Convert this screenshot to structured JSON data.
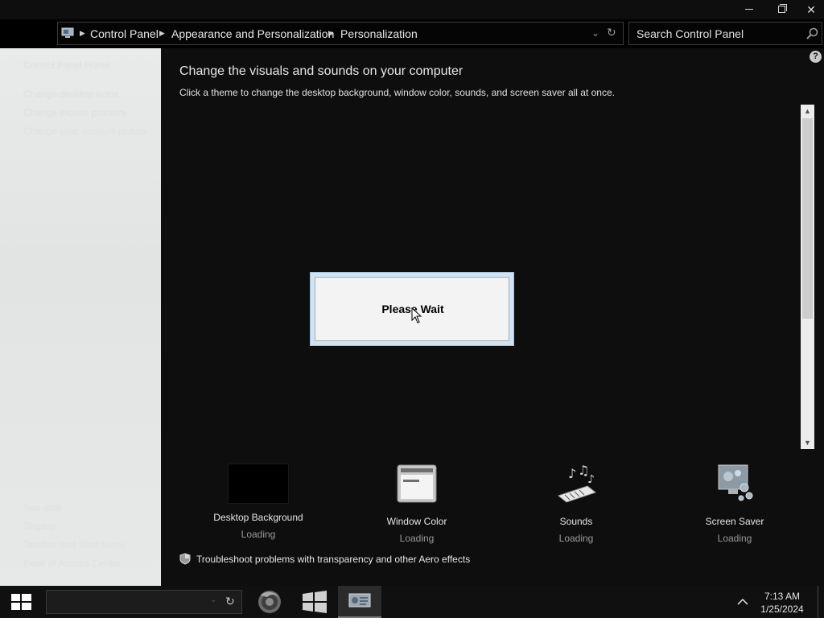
{
  "window": {
    "caption": {
      "minimize": "—",
      "restore": "❐",
      "close": "✕"
    }
  },
  "address_bar": {
    "breadcrumbs": [
      "Control Panel",
      "Appearance and Personalization",
      "Personalization"
    ],
    "dropdown_glyph": "⌄",
    "refresh_glyph": "↻"
  },
  "search": {
    "placeholder": "Search Control Panel"
  },
  "sidebar": {
    "home": "Control Panel Home",
    "links": [
      "Change desktop icons",
      "Change mouse pointers",
      "Change your account picture"
    ],
    "see_also_header": "See also",
    "see_also": [
      "Display",
      "Taskbar and Start Menu",
      "Ease of Access Center"
    ]
  },
  "main": {
    "title": "Change the visuals and sounds on your computer",
    "subtitle": "Click a theme to change the desktop background, window color, sounds, and screen saver all at once.",
    "help_glyph": "?",
    "dialog_text": "Please Wait",
    "tools": [
      {
        "label": "Desktop Background",
        "status": "Loading"
      },
      {
        "label": "Window Color",
        "status": "Loading"
      },
      {
        "label": "Sounds",
        "status": "Loading"
      },
      {
        "label": "Screen Saver",
        "status": "Loading"
      }
    ],
    "troubleshoot": "Troubleshoot problems with transparency and other Aero effects"
  },
  "taskbar": {
    "search_refresh_glyph": "↻",
    "apps": [
      "firefox-icon",
      "windows-logo-icon",
      "control-panel-icon"
    ],
    "time": "7:13 AM",
    "date": "1/25/2024"
  },
  "colors": {
    "background": "#0e0e0e",
    "sidebar": "#e6e8e8",
    "dialog_frame": "#cfe3f2",
    "scrollbar": "#ececec"
  }
}
